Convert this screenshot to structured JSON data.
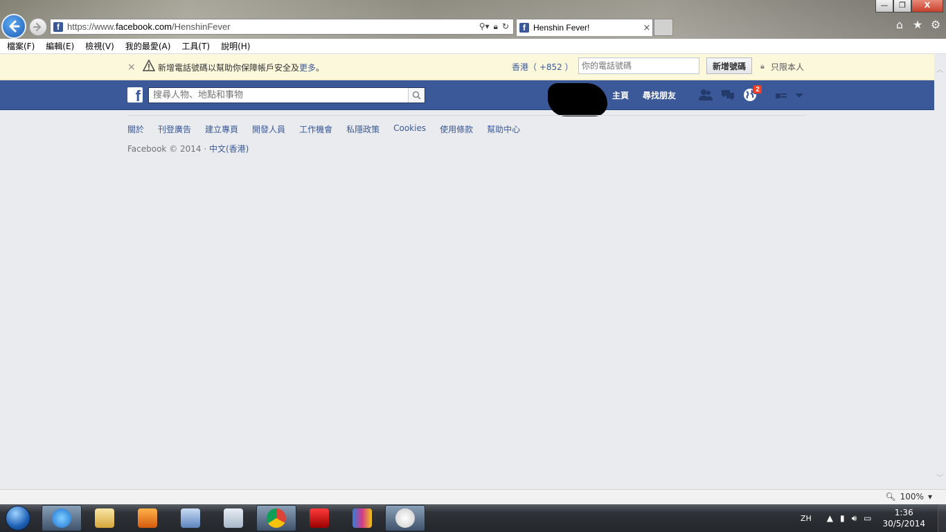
{
  "window": {
    "minimize_label": "—",
    "restore_label": "❐",
    "close_label": "X"
  },
  "address_bar": {
    "url_prefix": "https://www.",
    "url_domain": "facebook.com",
    "url_path": "/HenshinFever"
  },
  "tab": {
    "title": "Henshin Fever!",
    "close_label": "×"
  },
  "menu": {
    "items": [
      "檔案(F)",
      "編輯(E)",
      "檢視(V)",
      "我的最愛(A)",
      "工具(T)",
      "說明(H)"
    ]
  },
  "notice": {
    "close_label": "×",
    "message": "新增電話號碼以幫助你保障帳戶安全及",
    "more_link": "更多",
    "suffix": "。",
    "country": "香港（ +852 ）",
    "phone_placeholder": "你的電話號碼",
    "add_button": "新增號碼",
    "privacy": "只限本人"
  },
  "fb_header": {
    "search_placeholder": "搜尋人物、地點和事物",
    "nav_home": "主頁",
    "nav_find_friends": "尋找朋友",
    "notifications_count": "2"
  },
  "footer": {
    "links": [
      "關於",
      "刊登廣告",
      "建立專頁",
      "開發人員",
      "工作機會",
      "私隱政策",
      "Cookies",
      "使用條款",
      "幫助中心"
    ],
    "copyright": "Facebook © 2014 · ",
    "language": "中文(香港)"
  },
  "statusbar": {
    "zoom": "100%"
  },
  "taskbar": {
    "lang": "ZH",
    "time": "1:36",
    "date": "30/5/2014"
  },
  "colors": {
    "facebook_blue": "#3b5998",
    "notice_bg": "#fcf8dc",
    "page_bg": "#e9ebee",
    "badge_red": "#f03d25"
  }
}
